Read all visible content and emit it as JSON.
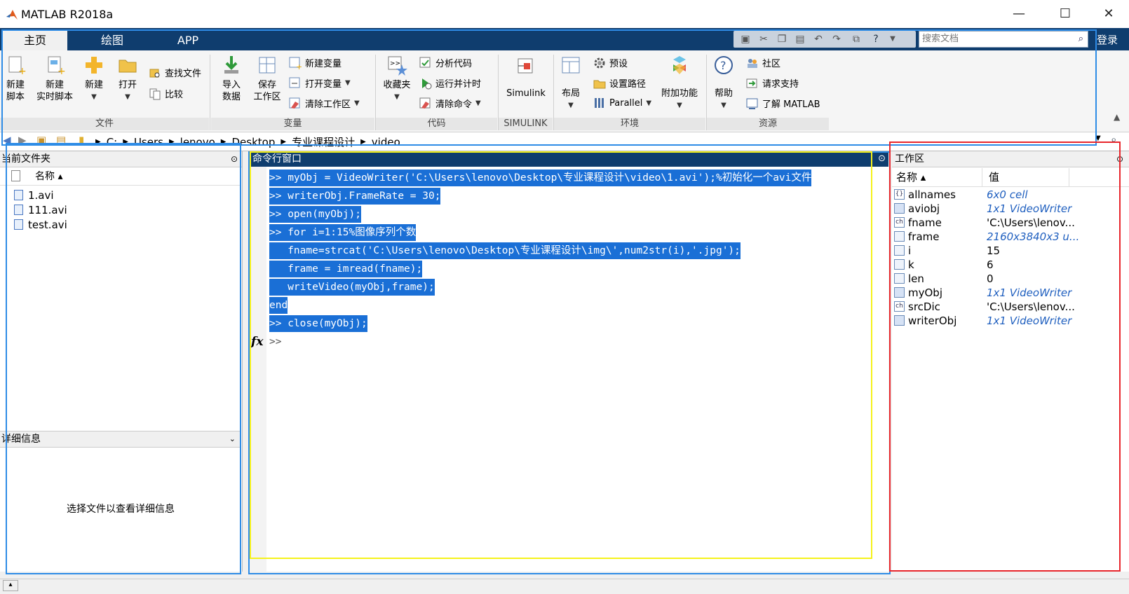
{
  "window": {
    "title": "MATLAB R2018a",
    "minimize": "—",
    "maximize": "☐",
    "close": "✕"
  },
  "tabs": [
    {
      "label": "主页"
    },
    {
      "label": "绘图"
    },
    {
      "label": "APP"
    }
  ],
  "search": {
    "placeholder": "搜索文档"
  },
  "login": "登录",
  "ribbon": {
    "file": {
      "new_script": "新建\n脚本",
      "new_live": "新建\n实时脚本",
      "new": "新建",
      "open": "打开",
      "find_files": "查找文件",
      "compare": "比较",
      "group": "文件"
    },
    "variable": {
      "import": "导入\n数据",
      "save_ws": "保存\n工作区",
      "new_var": "新建变量",
      "open_var": "打开变量",
      "clear_ws": "清除工作区",
      "group": "变量"
    },
    "code": {
      "favorites": "收藏夹",
      "analyze": "分析代码",
      "run_time": "运行并计时",
      "clear_cmd": "清除命令",
      "group": "代码"
    },
    "simulink": {
      "label": "Simulink",
      "group": "SIMULINK"
    },
    "env": {
      "layout": "布局",
      "prefs": "预设",
      "set_path": "设置路径",
      "parallel": "Parallel",
      "addons": "附加功能",
      "group": "环境"
    },
    "resources": {
      "help": "帮助",
      "community": "社区",
      "support": "请求支持",
      "learn": "了解 MATLAB",
      "group": "资源"
    }
  },
  "path": {
    "segments": [
      "C:",
      "Users",
      "lenovo",
      "Desktop",
      "专业课程设计",
      "video"
    ]
  },
  "current_folder": {
    "title": "当前文件夹",
    "col_name": "名称 ▴",
    "files": [
      "1.avi",
      "111.avi",
      "test.avi"
    ],
    "details_title": "详细信息",
    "details_hint": "选择文件以查看详细信息"
  },
  "command_window": {
    "title": "命令行窗口",
    "lines": [
      ">> myObj = VideoWriter('C:\\Users\\lenovo\\Desktop\\专业课程设计\\video\\1.avi');%初始化一个avi文件",
      ">> writerObj.FrameRate = 30;",
      ">> open(myObj);",
      ">> for i=1:15%图像序列个数",
      "   fname=strcat('C:\\Users\\lenovo\\Desktop\\专业课程设计\\img\\',num2str(i),'.jpg');",
      "   frame = imread(fname);",
      "   writeVideo(myObj,frame);",
      "end",
      ">> close(myObj);"
    ],
    "prompt": ">>",
    "fx": "fx"
  },
  "workspace": {
    "title": "工作区",
    "col_name": "名称 ▴",
    "col_value": "值",
    "vars": [
      {
        "name": "allnames",
        "value": "6x0 cell",
        "icon": "{}",
        "italic": true
      },
      {
        "name": "aviobj",
        "value": "1x1 VideoWriter",
        "icon": "obj",
        "italic": true
      },
      {
        "name": "fname",
        "value": "'C:\\Users\\lenov...",
        "icon": "ch",
        "italic": false
      },
      {
        "name": "frame",
        "value": "2160x3840x3 u...",
        "icon": "mat",
        "italic": true
      },
      {
        "name": "i",
        "value": "15",
        "icon": "mat",
        "italic": false
      },
      {
        "name": "k",
        "value": "6",
        "icon": "mat",
        "italic": false
      },
      {
        "name": "len",
        "value": "0",
        "icon": "mat",
        "italic": false
      },
      {
        "name": "myObj",
        "value": "1x1 VideoWriter",
        "icon": "obj",
        "italic": true
      },
      {
        "name": "srcDic",
        "value": "'C:\\Users\\lenov...",
        "icon": "ch",
        "italic": false
      },
      {
        "name": "writerObj",
        "value": "1x1 VideoWriter",
        "icon": "obj",
        "italic": true
      }
    ]
  },
  "colors": {
    "tab_strip": "#0f3d6e",
    "highlight": "#1a6fd6",
    "blue_box": "#2e8ce6",
    "yellow_box": "#f5f21a",
    "red_box": "#e8262c"
  }
}
